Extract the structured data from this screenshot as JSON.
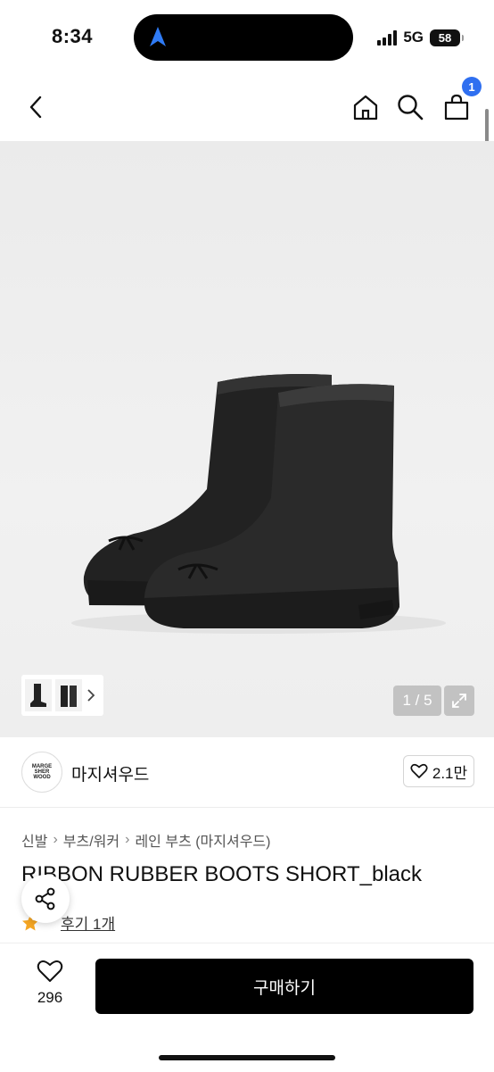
{
  "status": {
    "time": "8:34",
    "network": "5G",
    "battery": "58"
  },
  "nav": {
    "cart_count": "1"
  },
  "gallery": {
    "counter": "1 / 5"
  },
  "brand": {
    "logo_text": "MARGE SHER WOOD",
    "name": "마지셔우드",
    "likes": "2.1만"
  },
  "breadcrumb": [
    "신발",
    "부츠/워커",
    "레인 부츠 (마지셔우드)"
  ],
  "product": {
    "title": "RIBBON RUBBER BOOTS SHORT_black",
    "review_link": "후기 1개"
  },
  "bottom": {
    "wish_count": "296",
    "buy_label": "구매하기"
  },
  "colors": {
    "accent": "#2f6ff0",
    "buy_button": "#000000",
    "star": "#f5a623"
  }
}
